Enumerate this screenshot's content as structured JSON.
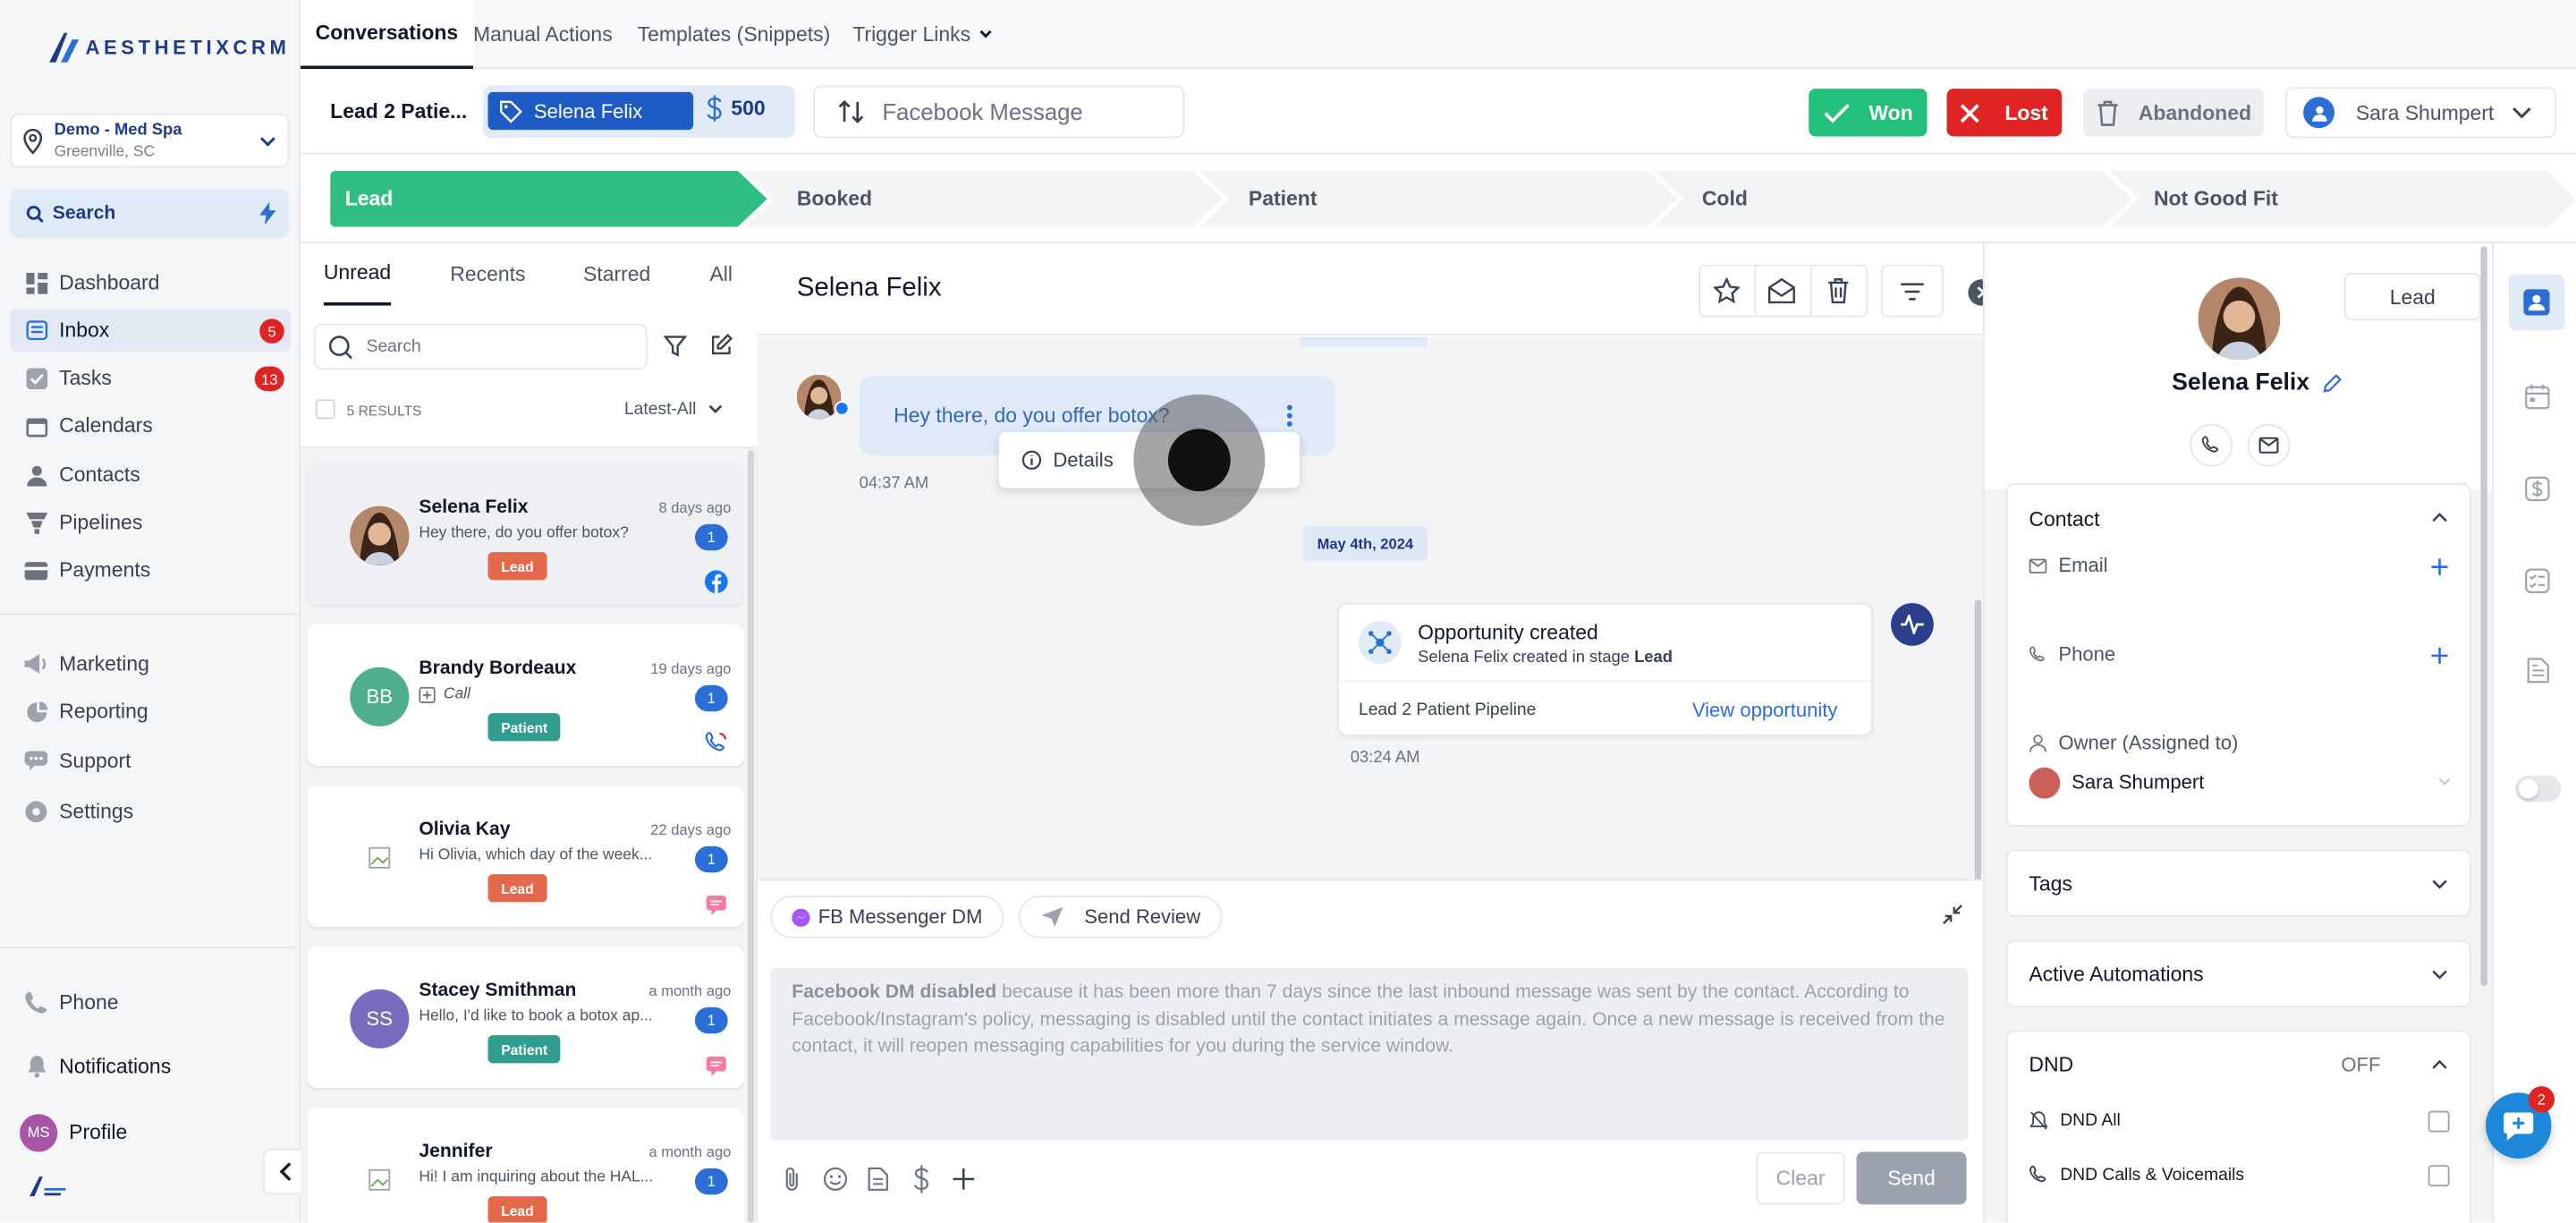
{
  "app": {
    "logo_text": "AESTHETIXCRM"
  },
  "location": {
    "name": "Demo - Med Spa",
    "city": "Greenville, SC"
  },
  "search": {
    "label": "Search"
  },
  "nav": {
    "items": [
      {
        "label": "Dashboard",
        "icon": "dashboard-icon"
      },
      {
        "label": "Inbox",
        "icon": "inbox-icon",
        "badge": "5"
      },
      {
        "label": "Tasks",
        "icon": "tasks-icon",
        "badge": "13"
      },
      {
        "label": "Calendars",
        "icon": "calendar-icon"
      },
      {
        "label": "Contacts",
        "icon": "contacts-icon"
      },
      {
        "label": "Pipelines",
        "icon": "pipelines-icon"
      },
      {
        "label": "Payments",
        "icon": "payments-icon"
      }
    ],
    "items2": [
      {
        "label": "Marketing",
        "icon": "marketing-icon"
      },
      {
        "label": "Reporting",
        "icon": "reporting-icon"
      },
      {
        "label": "Support",
        "icon": "support-icon"
      },
      {
        "label": "Settings",
        "icon": "settings-icon"
      }
    ],
    "bottom": [
      {
        "label": "Phone",
        "icon": "phone-icon"
      },
      {
        "label": "Notifications",
        "icon": "bell-icon"
      },
      {
        "label": "Profile",
        "icon": "profile-avatar",
        "initials": "MS"
      }
    ]
  },
  "toptabs": {
    "conversations": "Conversations",
    "manual_actions": "Manual Actions",
    "templates": "Templates (Snippets)",
    "trigger_links": "Trigger Links"
  },
  "opportunity": {
    "name": "Lead 2 Patie...",
    "contact": "Selena Felix",
    "value": "500",
    "channel_placeholder": "Facebook Message",
    "won": "Won",
    "lost": "Lost",
    "abandoned": "Abandoned",
    "owner": "Sara Shumpert"
  },
  "stages": [
    "Lead",
    "Booked",
    "Patient",
    "Cold",
    "Not Good Fit"
  ],
  "conv_tabs": {
    "unread": "Unread",
    "recents": "Recents",
    "starred": "Starred",
    "all": "All"
  },
  "conv_search": {
    "placeholder": "Search"
  },
  "results": {
    "count": "5 RESULTS",
    "sort": "Latest-All"
  },
  "conversations": [
    {
      "name": "Selena Felix",
      "preview": "Hey there, do you offer botox?",
      "time": "8 days ago",
      "unread": "1",
      "tag": "Lead",
      "tag_color": "#e4694a",
      "source": "facebook-icon"
    },
    {
      "name": "Brandy Bordeaux",
      "initials": "BB",
      "preview": "Call",
      "time": "19 days ago",
      "unread": "1",
      "tag": "Patient",
      "tag_color": "#2f9e8f",
      "source": "phone-call-icon"
    },
    {
      "name": "Olivia Kay",
      "preview": "Hi Olivia, which day of the week...",
      "time": "22 days ago",
      "unread": "1",
      "tag": "Lead",
      "tag_color": "#e4694a",
      "source": "sms-icon"
    },
    {
      "name": "Stacey Smithman",
      "initials": "SS",
      "preview": "Hello, I'd like to book a botox ap...",
      "time": "a month ago",
      "unread": "1",
      "tag": "Patient",
      "tag_color": "#2f9e8f",
      "source": "sms-icon"
    },
    {
      "name": "Jennifer",
      "preview": "Hi! I am inquiring about the HAL...",
      "time": "a month ago",
      "unread": "1",
      "tag": "Lead",
      "tag_color": "#e4694a",
      "source": "sms-icon"
    }
  ],
  "chat": {
    "title": "Selena Felix",
    "message": "Hey there, do you offer botox?",
    "message_time": "04:37 AM",
    "details_menu": "Details",
    "date_divider": "May 4th, 2024",
    "activity": {
      "title": "Opportunity created",
      "text_pre": "Selena Felix created in stage ",
      "text_stage": "Lead",
      "pipeline": "Lead 2 Patient Pipeline",
      "link": "View opportunity",
      "time": "03:24 AM"
    },
    "channels": {
      "messenger": "FB Messenger DM",
      "review": "Send Review"
    },
    "disabled_bold": "Facebook DM disabled",
    "disabled_text": " because it has been more than 7 days since the last inbound message was sent by the contact. According to Facebook/Instagram's policy, messaging is disabled until the contact initiates a message again. Once a new message is received from the contact, it will reopen messaging capabilities for you during the service window.",
    "clear": "Clear",
    "send": "Send"
  },
  "contact": {
    "name": "Selena Felix",
    "stage_badge": "Lead",
    "section_contact": "Contact",
    "email": "Email",
    "phone": "Phone",
    "owner_label": "Owner (Assigned to)",
    "owner": "Sara Shumpert",
    "tags": "Tags",
    "automations": "Active Automations",
    "dnd": "DND",
    "dnd_state": "OFF",
    "dnd_all": "DND All",
    "dnd_calls": "DND Calls & Voicemails"
  },
  "chat_widget_badge": "2",
  "colors": {
    "accent": "#2b6ed6",
    "won": "#22c07a",
    "lost": "#e02424",
    "stage_active": "#2fbf85"
  }
}
